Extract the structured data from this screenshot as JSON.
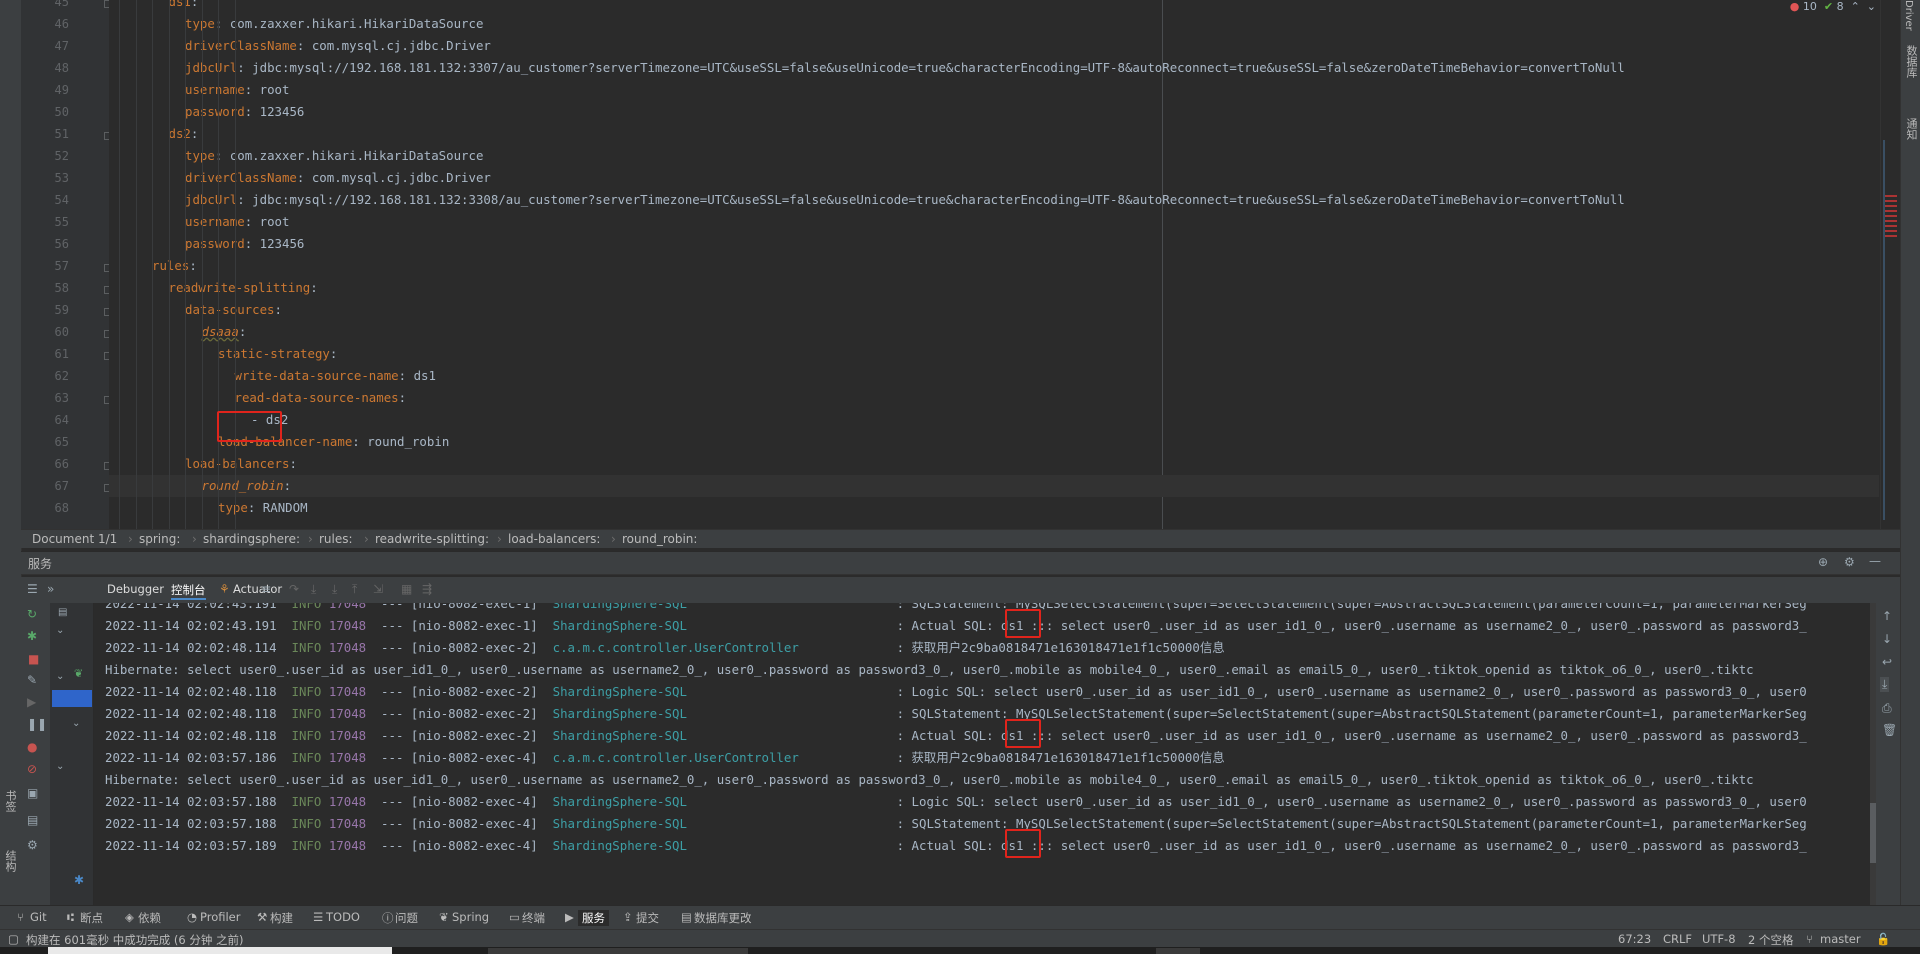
{
  "inspections": {
    "errors": "10",
    "warnings": "8"
  },
  "editor": {
    "lines": [
      {
        "num": "45",
        "key": "ds1",
        "val": ""
      },
      {
        "num": "46",
        "key": "type",
        "val": "com.zaxxer.hikari.HikariDataSource"
      },
      {
        "num": "47",
        "key": "driverClassName",
        "val": "com.mysql.cj.jdbc.Driver"
      },
      {
        "num": "48",
        "key": "jdbcUrl",
        "val": "jdbc:mysql://192.168.181.132:3307/au_customer?serverTimezone=UTC&useSSL=false&useUnicode=true&characterEncoding=UTF-8&autoReconnect=true&useSSL=false&zeroDateTimeBehavior=convertToNull"
      },
      {
        "num": "49",
        "key": "username",
        "val": "root"
      },
      {
        "num": "50",
        "key": "password",
        "val": "123456"
      },
      {
        "num": "51",
        "key": "ds2",
        "val": ""
      },
      {
        "num": "52",
        "key": "type",
        "val": "com.zaxxer.hikari.HikariDataSource"
      },
      {
        "num": "53",
        "key": "driverClassName",
        "val": "com.mysql.cj.jdbc.Driver"
      },
      {
        "num": "54",
        "key": "jdbcUrl",
        "val": "jdbc:mysql://192.168.181.132:3308/au_customer?serverTimezone=UTC&useSSL=false&useUnicode=true&characterEncoding=UTF-8&autoReconnect=true&useSSL=false&zeroDateTimeBehavior=convertToNull"
      },
      {
        "num": "55",
        "key": "username",
        "val": "root"
      },
      {
        "num": "56",
        "key": "password",
        "val": "123456"
      },
      {
        "num": "57",
        "key": "rules",
        "val": ""
      },
      {
        "num": "58",
        "key": "readwrite-splitting",
        "val": ""
      },
      {
        "num": "59",
        "key": "data-sources",
        "val": ""
      },
      {
        "num": "60",
        "key": "dsaaa",
        "val": ""
      },
      {
        "num": "61",
        "key": "static-strategy",
        "val": ""
      },
      {
        "num": "62",
        "key": "write-data-source-name",
        "val": "ds1"
      },
      {
        "num": "63",
        "key": "read-data-source-names",
        "val": ""
      },
      {
        "num": "64",
        "key": "",
        "val": "- ds2"
      },
      {
        "num": "65",
        "key": "load-balancer-name",
        "val": "round_robin"
      },
      {
        "num": "66",
        "key": "load-balancers",
        "val": ""
      },
      {
        "num": "67",
        "key": "round_robin",
        "val": ""
      },
      {
        "num": "68",
        "key": "type",
        "val": "RANDOM"
      }
    ]
  },
  "breadcrumb": [
    "Document 1/1",
    "spring:",
    "shardingsphere:",
    "rules:",
    "readwrite-splitting:",
    "load-balancers:",
    "round_robin:"
  ],
  "services": {
    "title": "服务",
    "tabs": [
      "Debugger",
      "控制台",
      "Actuator"
    ],
    "log": [
      {
        "ts": "2022-11-14 02:02:43.191",
        "level": "INFO",
        "pid": "17048",
        "thread": "--- [nio-8082-exec-1]",
        "logger": "ShardingSphere-SQL",
        "msg": ": SQLStatement: MySQLSelectStatement(super=SelectStatement(super=AbstractSQLStatement(parameterCount=1, parameterMarkerSeg"
      },
      {
        "ts": "2022-11-14 02:02:43.191",
        "level": "INFO",
        "pid": "17048",
        "thread": "--- [nio-8082-exec-1]",
        "logger": "ShardingSphere-SQL",
        "msg": ": Actual SQL: ds1 ::: select user0_.user_id as user_id1_0_, user0_.username as username2_0_, user0_.password as password3_"
      },
      {
        "ts": "2022-11-14 02:02:48.114",
        "level": "INFO",
        "pid": "17048",
        "thread": "--- [nio-8082-exec-2]",
        "logger": "c.a.m.c.controller.UserController",
        "msg": ": 获取用户2c9ba0818471e163018471e1f1c50000信息"
      },
      {
        "plain": "Hibernate: select user0_.user_id as user_id1_0_, user0_.username as username2_0_, user0_.password as password3_0_, user0_.mobile as mobile4_0_, user0_.email as email5_0_, user0_.tiktok_openid as tiktok_o6_0_, user0_.tiktc"
      },
      {
        "ts": "2022-11-14 02:02:48.118",
        "level": "INFO",
        "pid": "17048",
        "thread": "--- [nio-8082-exec-2]",
        "logger": "ShardingSphere-SQL",
        "msg": ": Logic SQL: select user0_.user_id as user_id1_0_, user0_.username as username2_0_, user0_.password as password3_0_, user0"
      },
      {
        "ts": "2022-11-14 02:02:48.118",
        "level": "INFO",
        "pid": "17048",
        "thread": "--- [nio-8082-exec-2]",
        "logger": "ShardingSphere-SQL",
        "msg": ": SQLStatement: MySQLSelectStatement(super=SelectStatement(super=AbstractSQLStatement(parameterCount=1, parameterMarkerSeg"
      },
      {
        "ts": "2022-11-14 02:02:48.118",
        "level": "INFO",
        "pid": "17048",
        "thread": "--- [nio-8082-exec-2]",
        "logger": "ShardingSphere-SQL",
        "msg": ": Actual SQL: ds1 ::: select user0_.user_id as user_id1_0_, user0_.username as username2_0_, user0_.password as password3_"
      },
      {
        "ts": "2022-11-14 02:03:57.186",
        "level": "INFO",
        "pid": "17048",
        "thread": "--- [nio-8082-exec-4]",
        "logger": "c.a.m.c.controller.UserController",
        "msg": ": 获取用户2c9ba0818471e163018471e1f1c50000信息"
      },
      {
        "plain": "Hibernate: select user0_.user_id as user_id1_0_, user0_.username as username2_0_, user0_.password as password3_0_, user0_.mobile as mobile4_0_, user0_.email as email5_0_, user0_.tiktok_openid as tiktok_o6_0_, user0_.tiktc"
      },
      {
        "ts": "2022-11-14 02:03:57.188",
        "level": "INFO",
        "pid": "17048",
        "thread": "--- [nio-8082-exec-4]",
        "logger": "ShardingSphere-SQL",
        "msg": ": Logic SQL: select user0_.user_id as user_id1_0_, user0_.username as username2_0_, user0_.password as password3_0_, user0"
      },
      {
        "ts": "2022-11-14 02:03:57.188",
        "level": "INFO",
        "pid": "17048",
        "thread": "--- [nio-8082-exec-4]",
        "logger": "ShardingSphere-SQL",
        "msg": ": SQLStatement: MySQLSelectStatement(super=SelectStatement(super=AbstractSQLStatement(parameterCount=1, parameterMarkerSeg"
      },
      {
        "ts": "2022-11-14 02:03:57.189",
        "level": "INFO",
        "pid": "17048",
        "thread": "--- [nio-8082-exec-4]",
        "logger": "ShardingSphere-SQL",
        "msg": ": Actual SQL: ds1 ::: select user0_.user_id as user_id1_0_, user0_.username as username2_0_, user0_.password as password3_"
      }
    ]
  },
  "left_strip": {
    "bookmarks": "书签",
    "structure": "结构"
  },
  "right_strip": {
    "database": "数据库",
    "notifications": "通知",
    "driver": "Driver"
  },
  "tool_tabs": [
    {
      "label": "Git",
      "icon": "git-icon"
    },
    {
      "label": "断点",
      "icon": "breakpoint-icon"
    },
    {
      "label": "依赖",
      "icon": "dependency-icon"
    },
    {
      "label": "Profiler",
      "icon": "profiler-icon"
    },
    {
      "label": "构建",
      "icon": "build-icon"
    },
    {
      "label": "TODO",
      "icon": "todo-icon"
    },
    {
      "label": "问题",
      "icon": "problems-icon"
    },
    {
      "label": "Spring",
      "icon": "spring-icon"
    },
    {
      "label": "终端",
      "icon": "terminal-icon"
    },
    {
      "label": "服务",
      "icon": "services-icon"
    },
    {
      "label": "提交",
      "icon": "commit-icon"
    },
    {
      "label": "数据库更改",
      "icon": "database-changes-icon"
    }
  ],
  "status": {
    "message": "构建在 601毫秒 中成功完成 (6 分钟 之前)",
    "position": "67:23",
    "line_sep": "CRLF",
    "encoding": "UTF-8",
    "indent": "2 个空格",
    "branch": "master"
  },
  "colors": {
    "accent_red": "#e0241c",
    "keyword": "#cc7832",
    "logger": "#3d9fa6",
    "info": "#6a8759",
    "pid": "#9876aa"
  }
}
